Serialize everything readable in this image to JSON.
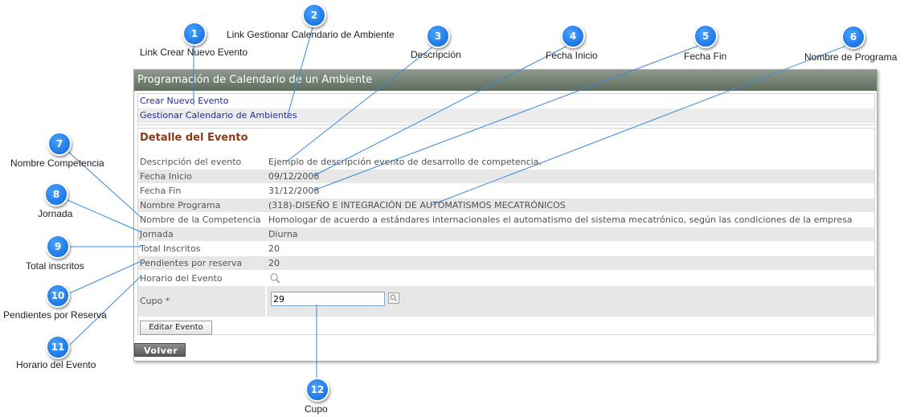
{
  "panel": {
    "title": "Programación de Calendario de un Ambiente",
    "links": {
      "crear": "Crear Nuevo Evento",
      "gestionar": "Gestionar Calendario de Ambientes"
    },
    "detail_title": "Detalle del Evento",
    "rows": [
      {
        "label": "Descripción del evento",
        "value": "Ejemplo de descripción evento de desarrollo de competencia."
      },
      {
        "label": "Fecha Inicio",
        "value": "09/12/2008"
      },
      {
        "label": "Fecha Fin",
        "value": "31/12/2008"
      },
      {
        "label": "Nombre Programa",
        "value": "(318)-DISEÑO E INTEGRACIÓN DE AUTOMATISMOS MECATRÓNICOS"
      },
      {
        "label": "Nombre de la Competencia",
        "value": "Homologar de acuerdo a estándares internacionales el automatismo del sistema mecatrónico, según las condiciones de la empresa"
      },
      {
        "label": "Jornada",
        "value": "Diurna"
      },
      {
        "label": "Total Inscritos",
        "value": "20"
      },
      {
        "label": "Pendientes por reserva",
        "value": "20"
      },
      {
        "label": "Horario del Evento",
        "icon": "search-icon"
      }
    ],
    "cupo": {
      "label": "Cupo *",
      "value": "29"
    },
    "edit_button": "Editar Evento",
    "back_button": "Volver"
  },
  "callouts": [
    {
      "number": "1",
      "label": "Link Crear Nuevo Evento"
    },
    {
      "number": "2",
      "label": "Link Gestionar Calendario de Ambiente"
    },
    {
      "number": "3",
      "label": "Descripción"
    },
    {
      "number": "4",
      "label": "Fecha Inicio"
    },
    {
      "number": "5",
      "label": "Fecha Fin"
    },
    {
      "number": "6",
      "label": "Nombre de Programa"
    },
    {
      "number": "7",
      "label": "Nombre Competencia"
    },
    {
      "number": "8",
      "label": "Jornada"
    },
    {
      "number": "9",
      "label": "Total inscritos"
    },
    {
      "number": "10",
      "label": "Pendientes por Reserva"
    },
    {
      "number": "11",
      "label": "Horario del Evento"
    },
    {
      "number": "12",
      "label": "Cupo"
    }
  ],
  "colors": {
    "header": "#6f7d6e",
    "link": "#1e2b9e",
    "detail_title": "#8b3a1a",
    "badge": "#1a7cf0",
    "leader_line": "#3b8ad9"
  }
}
